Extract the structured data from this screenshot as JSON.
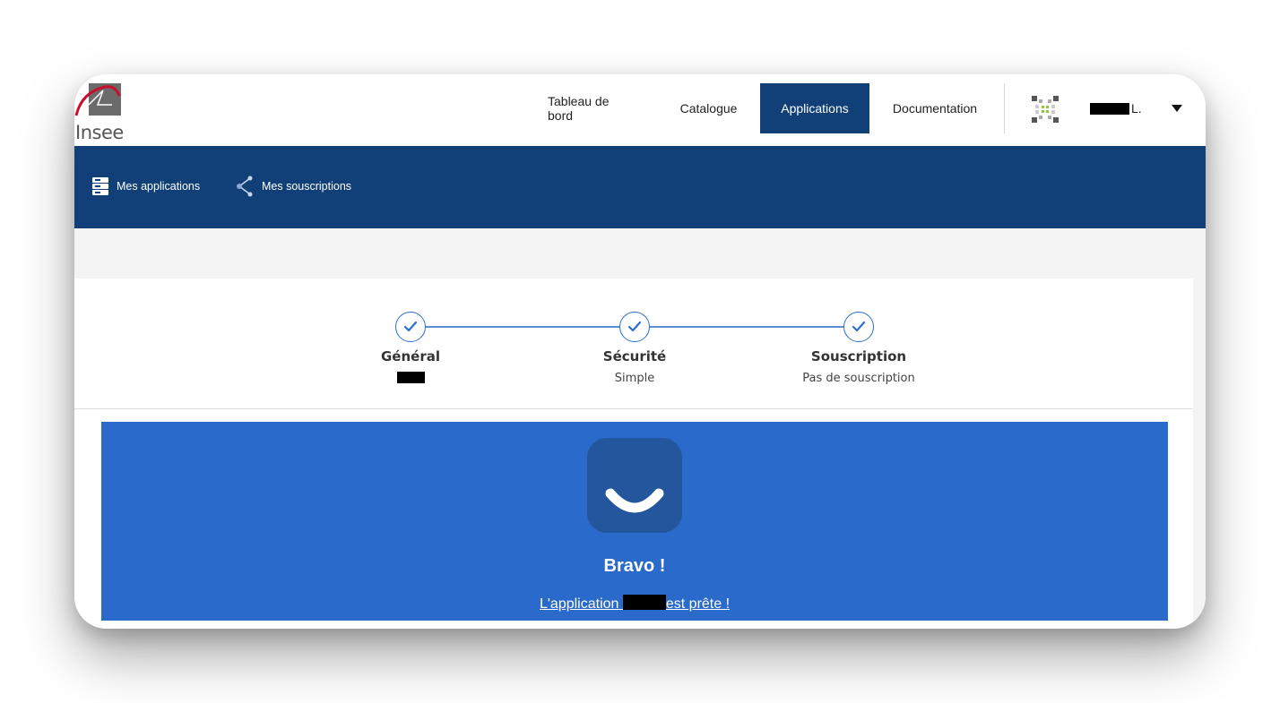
{
  "brand": {
    "logo_text": "Insee",
    "accent": "#c8102e"
  },
  "top_nav": {
    "items": [
      {
        "label": "Tableau de bord"
      },
      {
        "label": "Catalogue"
      },
      {
        "label": "Applications",
        "active": true
      },
      {
        "label": "Documentation"
      }
    ],
    "active_color": "#114079"
  },
  "user": {
    "name_suffix": "L.",
    "avatar_icon": "identicon-avatar",
    "menu_icon": "caret-down-icon"
  },
  "sub_nav": {
    "items": [
      {
        "label": "Mes applications",
        "icon": "server-stack-icon"
      },
      {
        "label": "Mes souscriptions",
        "icon": "share-icon"
      }
    ],
    "background": "#114079"
  },
  "stepper": {
    "steps": [
      {
        "title": "Général",
        "subtitle": "",
        "subtitle_redacted": true,
        "status": "complete"
      },
      {
        "title": "Sécurité",
        "subtitle": "Simple",
        "status": "complete"
      },
      {
        "title": "Souscription",
        "subtitle": "Pas de souscription",
        "status": "complete"
      }
    ]
  },
  "success": {
    "title": "Bravo !",
    "message_before": "L'application ",
    "message_after": "est prête !",
    "banner_color": "#2a6acb",
    "icon": "smile-icon"
  }
}
